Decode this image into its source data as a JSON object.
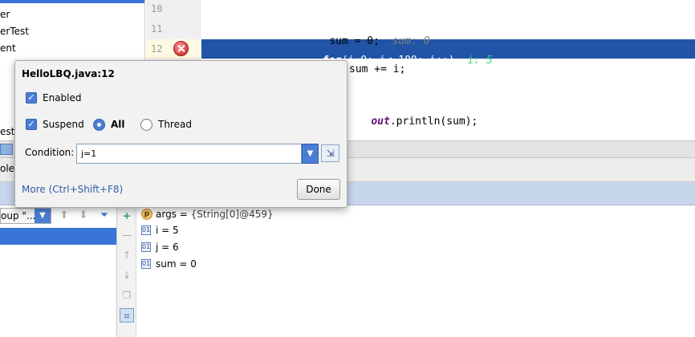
{
  "project_tree": {
    "items": [
      "er",
      "erTest",
      "ent",
      "est"
    ]
  },
  "editor": {
    "line_numbers": [
      "10",
      "11",
      "12"
    ],
    "line11": {
      "code": "sum = 0;",
      "inline_value": "sum: 0"
    },
    "line12": {
      "kw": "for",
      "code_a": "(i=0; i< ",
      "num": "100",
      "code_b": "; i++)",
      "inline_value": "i: 5"
    },
    "line13": {
      "code": "sum += i;"
    },
    "line15": {
      "field": "out",
      "code": ".println(sum);"
    }
  },
  "debug_strip": {
    "left_fragment": "ole"
  },
  "frames": {
    "thread_combo": "oup \"..."
  },
  "variables": {
    "items": [
      {
        "icon": "p",
        "name": "args",
        "value": "{String[0]@459}"
      },
      {
        "icon": "01",
        "name": "i",
        "value": "5"
      },
      {
        "icon": "01",
        "name": "j",
        "value": "6"
      },
      {
        "icon": "01",
        "name": "sum",
        "value": "0"
      }
    ]
  },
  "popup": {
    "title": "HelloLBQ.java:12",
    "enabled_label": "Enabled",
    "suspend_label": "Suspend",
    "all_label": "All",
    "thread_label": "Thread",
    "condition_label": "Condition:",
    "condition_value": "j=1",
    "more_link": "More (Ctrl+Shift+F8)",
    "done_label": "Done",
    "enabled": true,
    "suspend": true,
    "suspend_policy": "All"
  },
  "colors": {
    "selection": "#3875d7",
    "exec_line": "#2154a6",
    "inline_value": "#3ed27a",
    "breakpoint": "#e04848"
  }
}
